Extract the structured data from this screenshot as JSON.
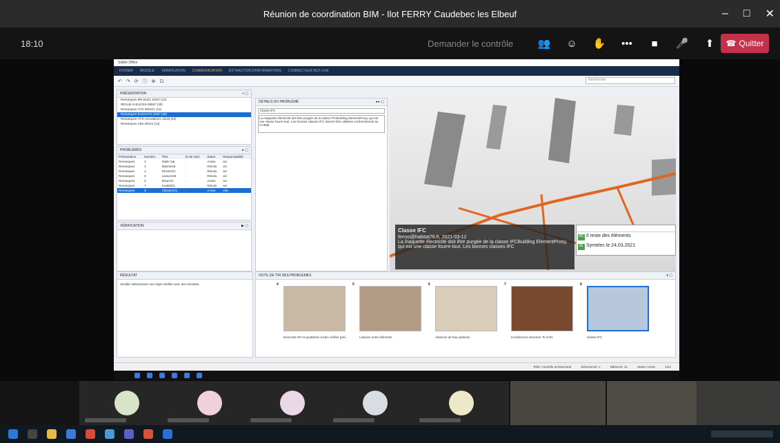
{
  "teams": {
    "window_title": "Réunion de coordination BIM - Ilot FERRY Caudebec les Elbeuf",
    "clock": "18:10",
    "request_control": "Demander le contrôle",
    "quit_label": "Quitter",
    "quit_color": "#c4314b"
  },
  "shared_app": {
    "presentation_header": "PRÉSENTATION",
    "presentation_items": [
      "Remarques MN ELEC 04/07 (14)",
      "REVUE-S-ELICES-08557 (30)",
      "Remarques HTS 09/22/1 (13)",
      "Remarques ELECHTS 10/07 (30)",
      "Remarques HTS-Annotations 10/19 (22)",
      "Remarques CBA 09/1/2 (13)"
    ],
    "problems_header": "PROBLÈMES",
    "problems_columns": [
      "Présentation",
      "Numéro",
      "Titre",
      "ID de suivi",
      "Statut",
      "Responsabilité"
    ],
    "problems_rows": [
      [
        "Remarques",
        "2",
        "Dalle Gaj",
        ".",
        "Active",
        "arc"
      ],
      [
        "Remarques",
        "3",
        "Mache/18",
        ".",
        "Résolu",
        "arc"
      ],
      [
        "Remarques",
        "4",
        "Dessin/21",
        ".",
        "Résolu",
        "arc"
      ],
      [
        "Remarques",
        "5",
        "Liaison/18",
        ".",
        "Résolu",
        "arc"
      ],
      [
        "Remarques",
        "6",
        "Mixer/21",
        ".",
        "Active",
        "arc"
      ],
      [
        "Remarques",
        "7",
        "Invalid/21",
        ".",
        "Résolu",
        "arc"
      ],
      [
        "Remarques",
        "8",
        "Classe/221",
        ".",
        "Active",
        "elec"
      ]
    ],
    "verification_header": "VÉRIFICATION",
    "result_header": "RÉSULTAT",
    "result_text": "Veuillez sélectionner une règle vérifiée avec des résultats.",
    "details_header": "DÉTAILS DU PROBLÈME",
    "detail_title_value": "Classe IFC",
    "detail_description": "La maquette électricité doit être purgée de la classe IFCBuilding ElementProxy, qui est une classe fourre-tout. Les bonnes classes IFC doivent être utilisées conformément au CCBIM",
    "info_title": "Classe IFC",
    "info_author": "ferryo@habitat76.fr, 2021-03-12",
    "info_text": "La maquette électricité doit être purgée de la classe IFCBuilding ElementProxy, qui est une classe fourre-tout. Les bonnes classes IFC",
    "chat_line1": "Il reste des éléments",
    "chat_line2": "Symelec le 24.03.2021",
    "strip_header": "OUTIL DE TRI DES PROBLÈMES",
    "thumbs": [
      {
        "num": "4",
        "label": "Descente EP et gouttières à bien vérifier (pré..."
      },
      {
        "num": "5",
        "label": "Liaisons entre éléments"
      },
      {
        "num": "6",
        "label": "Absence de faux plafond..."
      },
      {
        "num": "7",
        "label": "Incohérence structure Ts Archi"
      },
      {
        "num": "8",
        "label": "Classe IFC"
      }
    ],
    "status": [
      "Rôle: Contrôle architectural",
      "Sélectionné: 1",
      "Bâtiment: 21",
      "Statut: Active",
      "1/22"
    ]
  }
}
